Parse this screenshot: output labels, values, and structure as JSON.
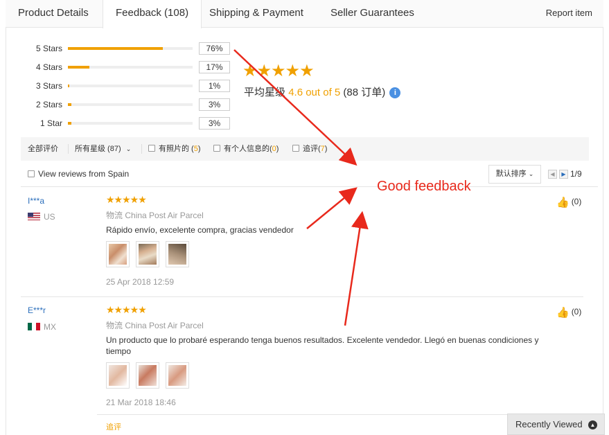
{
  "tabs": [
    {
      "label": "Product Details"
    },
    {
      "label": "Feedback (108)"
    },
    {
      "label": "Shipping & Payment"
    },
    {
      "label": "Seller Guarantees"
    }
  ],
  "report_link": "Report item",
  "distribution": [
    {
      "label": "5 Stars",
      "percent_text": "76%",
      "fill": 0.76
    },
    {
      "label": "4 Stars",
      "percent_text": "17%",
      "fill": 0.17
    },
    {
      "label": "3 Stars",
      "percent_text": "1%",
      "fill": 0.01
    },
    {
      "label": "2 Stars",
      "percent_text": "3%",
      "fill": 0.03
    },
    {
      "label": "1 Star",
      "percent_text": "3%",
      "fill": 0.03
    }
  ],
  "average": {
    "stars": "★★★★★",
    "label": "平均星级",
    "value": "4.6 out of 5",
    "orders": "(88 订单)",
    "info_icon": "i"
  },
  "filters": {
    "all_reviews": "全部评价",
    "all_stars": "所有星级 (87)",
    "with_photos_label": "有照片的",
    "with_photos_count": "5",
    "personal_info_label": "有个人信息的",
    "personal_info_count": "0",
    "follow_up_label": "追评",
    "follow_up_count": "7"
  },
  "view_spain": "View reviews from Spain",
  "sort_label": "默认排序",
  "pager": {
    "text": "1/9"
  },
  "reviews": [
    {
      "user": "I***a",
      "country": "US",
      "stars": "★★★★★",
      "logistics_label": "物流",
      "logistics_value": "China Post Air Parcel",
      "text": "Rápido envío, excelente compra, gracias vendedor",
      "date": "25 Apr 2018 12:59",
      "likes": "(0)"
    },
    {
      "user": "E***r",
      "country": "MX",
      "stars": "★★★★★",
      "logistics_label": "物流",
      "logistics_value": "China Post Air Parcel",
      "text": "Un producto que lo probaré esperando tenga buenos resultados. Excelente vendedor. Llegó en buenas condiciones y tiempo",
      "date": "21 Mar 2018 18:46",
      "likes": "(0)",
      "follow_up": "追评"
    }
  ],
  "recently_viewed": "Recently Viewed",
  "annotation": {
    "text": "Good feedback",
    "color": "#e8291c"
  },
  "accent_color": "#f0a000",
  "link_color": "#2a6ebb"
}
